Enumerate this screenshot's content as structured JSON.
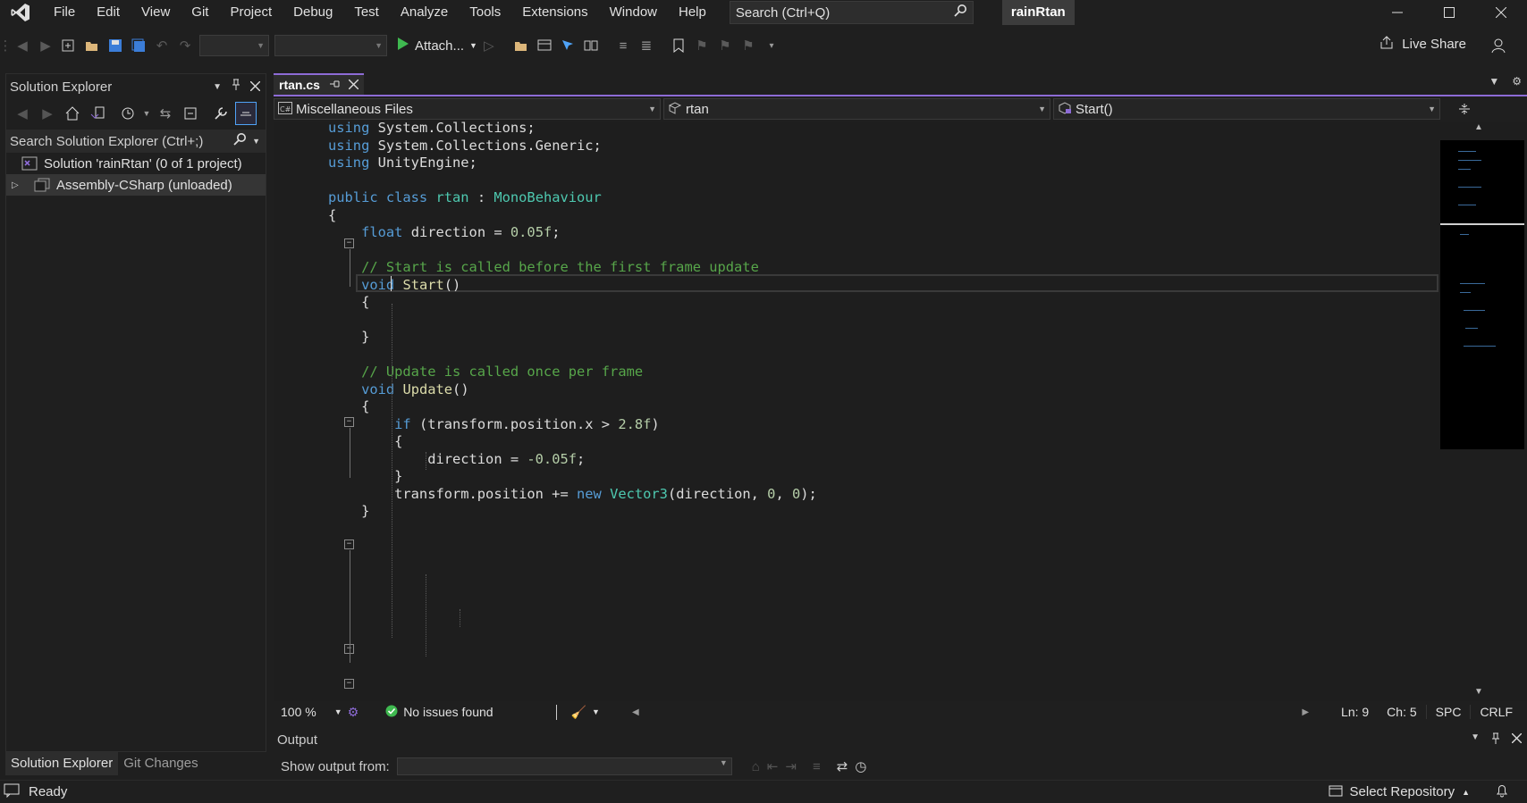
{
  "titlebar": {
    "menu": [
      "File",
      "Edit",
      "View",
      "Git",
      "Project",
      "Debug",
      "Test",
      "Analyze",
      "Tools",
      "Extensions",
      "Window",
      "Help"
    ],
    "search_placeholder": "Search (Ctrl+Q)",
    "solution_name": "rainRtan"
  },
  "toolbar": {
    "attach_label": "Attach...",
    "live_share_label": "Live Share"
  },
  "solution_explorer": {
    "title": "Solution Explorer",
    "search_placeholder": "Search Solution Explorer (Ctrl+;)",
    "tree": [
      {
        "label": "Solution 'rainRtan'   (0 of 1 project)"
      },
      {
        "label": "Assembly-CSharp (unloaded)"
      }
    ],
    "tabs": [
      "Solution Explorer",
      "Git Changes"
    ]
  },
  "editor": {
    "tab_title": "rtan.cs",
    "nav_project": "Miscellaneous Files",
    "nav_class": "rtan",
    "nav_member": "Start()",
    "code_lines": [
      [
        {
          "t": "using",
          "c": "kw"
        },
        {
          "t": " System.Collections;",
          "c": ""
        }
      ],
      [
        {
          "t": "using",
          "c": "kw"
        },
        {
          "t": " System.Collections.Generic;",
          "c": ""
        }
      ],
      [
        {
          "t": "using",
          "c": "kw"
        },
        {
          "t": " UnityEngine;",
          "c": ""
        }
      ],
      [],
      [
        {
          "t": "public class ",
          "c": "kw"
        },
        {
          "t": "rtan",
          "c": "ty"
        },
        {
          "t": " : ",
          "c": ""
        },
        {
          "t": "MonoBehaviour",
          "c": "ty"
        }
      ],
      [
        {
          "t": "{",
          "c": ""
        }
      ],
      [
        {
          "t": "    ",
          "c": ""
        },
        {
          "t": "float",
          "c": "kw"
        },
        {
          "t": " direction = ",
          "c": ""
        },
        {
          "t": "0.05f",
          "c": "nu"
        },
        {
          "t": ";",
          "c": ""
        }
      ],
      [],
      [
        {
          "t": "    ",
          "c": ""
        },
        {
          "t": "// Start is called before the first frame update",
          "c": "cm"
        }
      ],
      [
        {
          "t": "    ",
          "c": ""
        },
        {
          "t": "void",
          "c": "kw"
        },
        {
          "t": " ",
          "c": ""
        },
        {
          "t": "Start",
          "c": "fn"
        },
        {
          "t": "()",
          "c": ""
        }
      ],
      [
        {
          "t": "    {",
          "c": ""
        }
      ],
      [],
      [
        {
          "t": "    }",
          "c": ""
        }
      ],
      [],
      [
        {
          "t": "    ",
          "c": ""
        },
        {
          "t": "// Update is called once per frame",
          "c": "cm"
        }
      ],
      [
        {
          "t": "    ",
          "c": ""
        },
        {
          "t": "void",
          "c": "kw"
        },
        {
          "t": " ",
          "c": ""
        },
        {
          "t": "Update",
          "c": "fn"
        },
        {
          "t": "()",
          "c": ""
        }
      ],
      [
        {
          "t": "    {",
          "c": ""
        }
      ],
      [
        {
          "t": "        ",
          "c": ""
        },
        {
          "t": "if",
          "c": "kw"
        },
        {
          "t": " (transform.position.x > ",
          "c": ""
        },
        {
          "t": "2.8f",
          "c": "nu"
        },
        {
          "t": ")",
          "c": ""
        }
      ],
      [
        {
          "t": "        {",
          "c": ""
        }
      ],
      [
        {
          "t": "            direction = ",
          "c": ""
        },
        {
          "t": "-0.05f",
          "c": "nu"
        },
        {
          "t": ";",
          "c": ""
        }
      ],
      [
        {
          "t": "        }",
          "c": ""
        }
      ],
      [
        {
          "t": "        transform.position += ",
          "c": ""
        },
        {
          "t": "new",
          "c": "kw"
        },
        {
          "t": " ",
          "c": ""
        },
        {
          "t": "Vector3",
          "c": "ty"
        },
        {
          "t": "(direction, ",
          "c": ""
        },
        {
          "t": "0",
          "c": "nu"
        },
        {
          "t": ", ",
          "c": ""
        },
        {
          "t": "0",
          "c": "nu"
        },
        {
          "t": ");",
          "c": ""
        }
      ],
      [
        {
          "t": "    }",
          "c": ""
        }
      ]
    ],
    "zoom": "100 %",
    "issues": "No issues found",
    "line": "Ln: 9",
    "col": "Ch: 5",
    "whitespace": "SPC",
    "line_ending": "CRLF"
  },
  "output": {
    "title": "Output",
    "show_from_label": "Show output from:"
  },
  "statusbar": {
    "status": "Ready",
    "repo": "Select Repository"
  },
  "colors": {
    "accent": "#8d6bd6",
    "keyword": "#569cd6",
    "type": "#4ec9b0",
    "number": "#b5cea8",
    "comment": "#57a64a",
    "method": "#dcdcaa",
    "ok": "#3fb950"
  }
}
